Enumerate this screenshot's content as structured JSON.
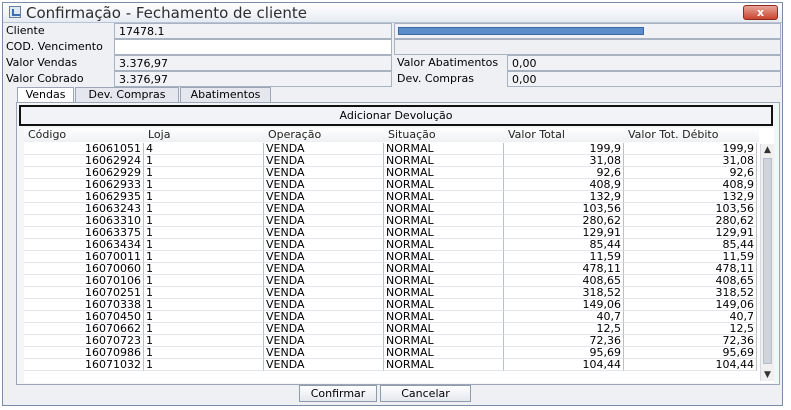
{
  "window": {
    "title": "Confirmação - Fechamento de cliente",
    "close_label": "x"
  },
  "form": {
    "cliente_label": "Cliente",
    "cliente_value": "17478.1",
    "cod_vencimento_label": "COD. Vencimento",
    "cod_vencimento_value": "",
    "valor_vendas_label": "Valor Vendas",
    "valor_vendas_value": "3.376,97",
    "valor_cobrado_label": "Valor Cobrado",
    "valor_cobrado_value": "3.376,97",
    "valor_abatimentos_label": "Valor Abatimentos",
    "valor_abatimentos_value": "0,00",
    "dev_compras_label": "Dev. Compras",
    "dev_compras_value": "0,00"
  },
  "tabs": [
    {
      "label": "Vendas",
      "active": true
    },
    {
      "label": "Dev. Compras",
      "active": false
    },
    {
      "label": "Abatimentos",
      "active": false
    }
  ],
  "actions": {
    "add_return_label": "Adicionar Devolução",
    "confirm_label": "Confirmar",
    "cancel_label": "Cancelar"
  },
  "table": {
    "columns": [
      "Código",
      "Loja",
      "Operação",
      "Situação",
      "Valor Total",
      "Valor Tot. Débito"
    ],
    "rows": [
      [
        "16061051",
        "4",
        "VENDA",
        "NORMAL",
        "199,9",
        "199,9"
      ],
      [
        "16062924",
        "1",
        "VENDA",
        "NORMAL",
        "31,08",
        "31,08"
      ],
      [
        "16062929",
        "1",
        "VENDA",
        "NORMAL",
        "92,6",
        "92,6"
      ],
      [
        "16062933",
        "1",
        "VENDA",
        "NORMAL",
        "408,9",
        "408,9"
      ],
      [
        "16062935",
        "1",
        "VENDA",
        "NORMAL",
        "132,9",
        "132,9"
      ],
      [
        "16063243",
        "1",
        "VENDA",
        "NORMAL",
        "103,56",
        "103,56"
      ],
      [
        "16063310",
        "1",
        "VENDA",
        "NORMAL",
        "280,62",
        "280,62"
      ],
      [
        "16063375",
        "1",
        "VENDA",
        "NORMAL",
        "129,91",
        "129,91"
      ],
      [
        "16063434",
        "1",
        "VENDA",
        "NORMAL",
        "85,44",
        "85,44"
      ],
      [
        "16070011",
        "1",
        "VENDA",
        "NORMAL",
        "11,59",
        "11,59"
      ],
      [
        "16070060",
        "1",
        "VENDA",
        "NORMAL",
        "478,11",
        "478,11"
      ],
      [
        "16070106",
        "1",
        "VENDA",
        "NORMAL",
        "408,65",
        "408,65"
      ],
      [
        "16070251",
        "1",
        "VENDA",
        "NORMAL",
        "318,52",
        "318,52"
      ],
      [
        "16070338",
        "1",
        "VENDA",
        "NORMAL",
        "149,06",
        "149,06"
      ],
      [
        "16070450",
        "1",
        "VENDA",
        "NORMAL",
        "40,7",
        "40,7"
      ],
      [
        "16070662",
        "1",
        "VENDA",
        "NORMAL",
        "12,5",
        "12,5"
      ],
      [
        "16070723",
        "1",
        "VENDA",
        "NORMAL",
        "72,36",
        "72,36"
      ],
      [
        "16070986",
        "1",
        "VENDA",
        "NORMAL",
        "95,69",
        "95,69"
      ],
      [
        "16071032",
        "1",
        "VENDA",
        "NORMAL",
        "104,44",
        "104,44"
      ]
    ]
  },
  "colors": {
    "progress_fill": "#5b8ec9",
    "close_button": "#c9442f"
  }
}
